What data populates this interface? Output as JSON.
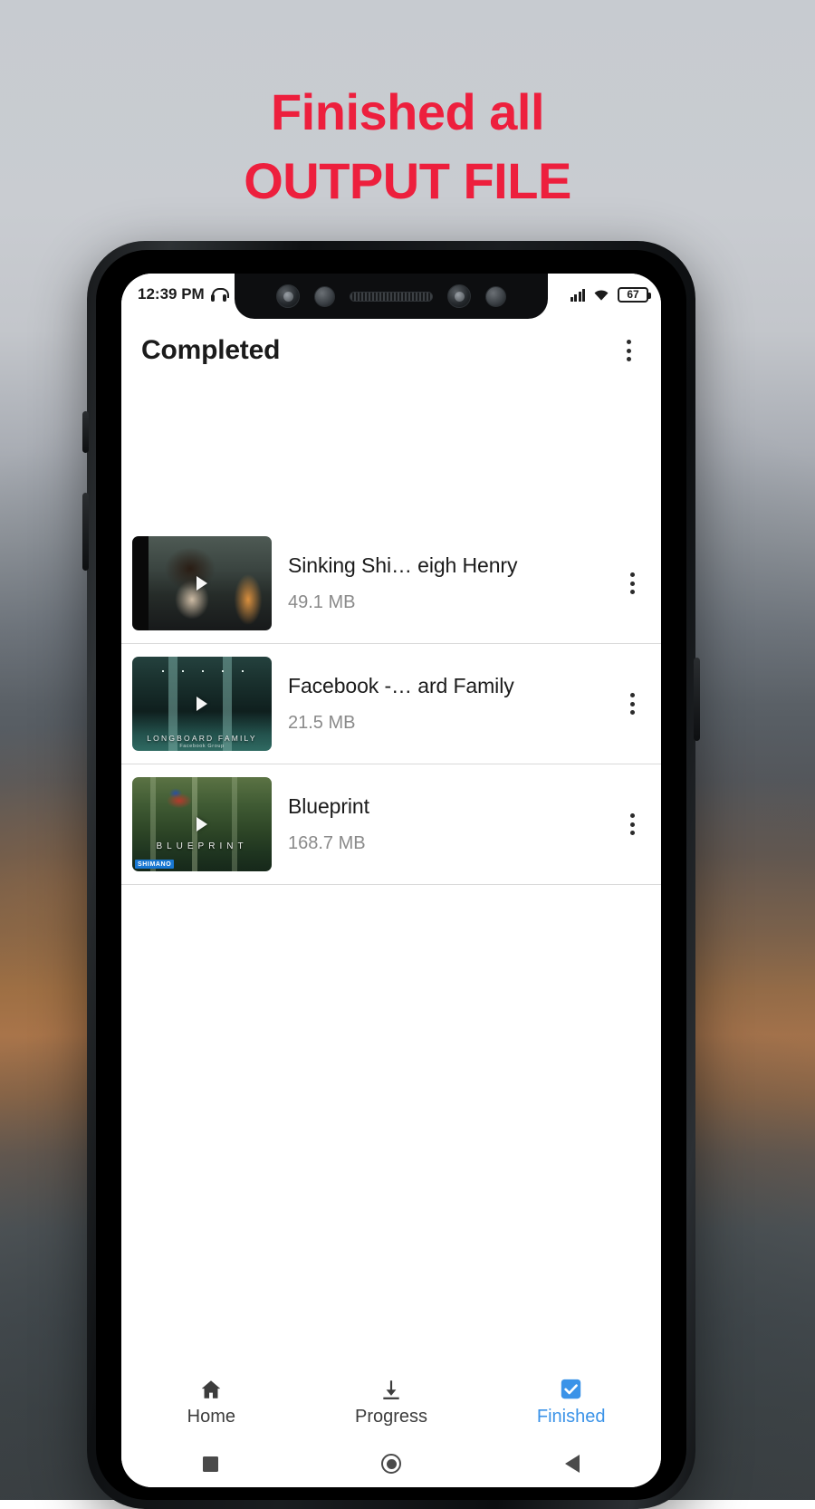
{
  "headline": {
    "line1": "Finished all",
    "line2": "OUTPUT FILE",
    "color": "#ed1f3d"
  },
  "statusbar": {
    "time": "12:39 PM",
    "headphone_icon": "headphone-icon",
    "signal_icon": "signal-bars-icon",
    "wifi_icon": "wifi-icon",
    "battery_level": "67"
  },
  "appbar": {
    "title": "Completed",
    "overflow_icon": "kebab-menu-icon"
  },
  "list": {
    "items": [
      {
        "title": "Sinking Shi… eigh Henry",
        "size": "49.1 MB",
        "thumb_caption": "",
        "thumb_caption_sub": "",
        "thumb_badge": "",
        "play_icon": "play-icon",
        "overflow_icon": "kebab-menu-icon"
      },
      {
        "title": "Facebook -… ard Family",
        "size": "21.5 MB",
        "thumb_caption": "LONGBOARD FAMILY",
        "thumb_caption_sub": "Facebook Group",
        "thumb_badge": "",
        "play_icon": "play-icon",
        "overflow_icon": "kebab-menu-icon"
      },
      {
        "title": "Blueprint",
        "size": "168.7 MB",
        "thumb_caption": "BLUEPRINT",
        "thumb_caption_sub": "",
        "thumb_badge": "SHIMANO",
        "play_icon": "play-icon",
        "overflow_icon": "kebab-menu-icon"
      }
    ]
  },
  "bottomnav": {
    "active_color": "#3b93e8",
    "items": [
      {
        "label": "Home",
        "icon": "home-icon",
        "active": false
      },
      {
        "label": "Progress",
        "icon": "download-icon",
        "active": false
      },
      {
        "label": "Finished",
        "icon": "check-box-icon",
        "active": true
      }
    ]
  },
  "sysnav": {
    "recents_icon": "square-recents-icon",
    "home_icon": "circle-home-icon",
    "back_icon": "triangle-back-icon"
  }
}
